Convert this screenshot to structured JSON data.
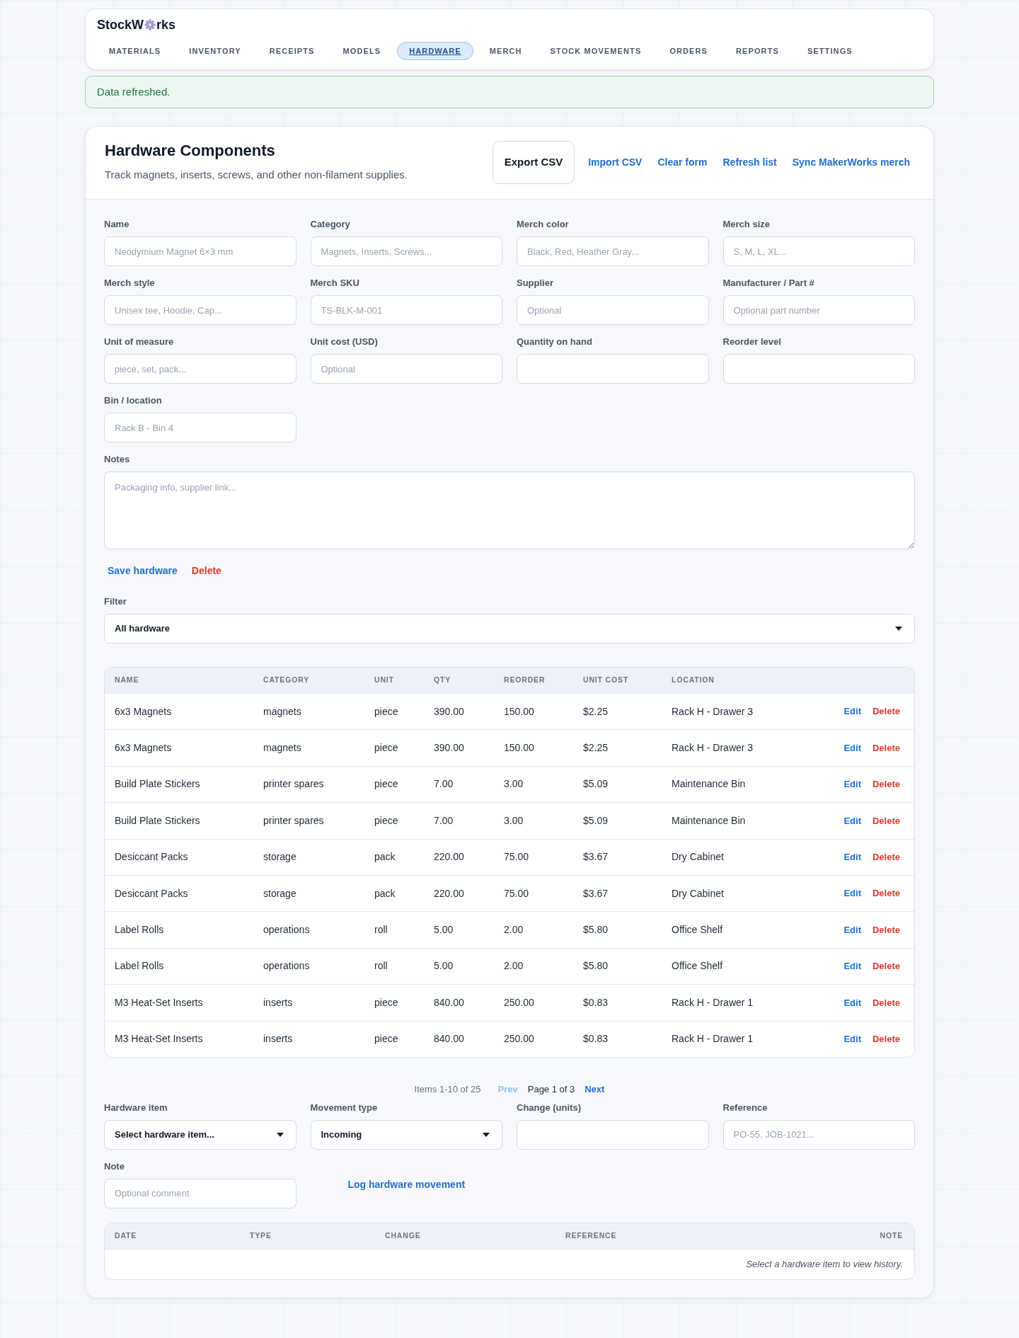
{
  "brand": {
    "text_start": "StockW",
    "text_end": "rks"
  },
  "nav": [
    {
      "label": "MATERIALS",
      "selected": false
    },
    {
      "label": "INVENTORY",
      "selected": false
    },
    {
      "label": "RECEIPTS",
      "selected": false
    },
    {
      "label": "MODELS",
      "selected": false
    },
    {
      "label": "HARDWARE",
      "selected": true
    },
    {
      "label": "MERCH",
      "selected": false
    },
    {
      "label": "STOCK MOVEMENTS",
      "selected": false
    },
    {
      "label": "ORDERS",
      "selected": false
    },
    {
      "label": "REPORTS",
      "selected": false
    },
    {
      "label": "SETTINGS",
      "selected": false
    }
  ],
  "alert": {
    "message": "Data refreshed."
  },
  "panel": {
    "title": "Hardware Components",
    "subtitle": "Track magnets, inserts, screws, and other non-filament supplies.",
    "actions": [
      {
        "label": "Export CSV",
        "kind": "outlined"
      },
      {
        "label": "Import CSV",
        "kind": "link"
      },
      {
        "label": "Clear form",
        "kind": "link"
      },
      {
        "label": "Refresh list",
        "kind": "link"
      },
      {
        "label": "Sync MakerWorks merch",
        "kind": "link"
      }
    ]
  },
  "form": {
    "fields": [
      {
        "label": "Name",
        "placeholder": "Neodymium Magnet 6×3 mm"
      },
      {
        "label": "Category",
        "placeholder": "Magnets, Inserts, Screws..."
      },
      {
        "label": "Merch color",
        "placeholder": "Black, Red, Heather Gray..."
      },
      {
        "label": "Merch size",
        "placeholder": "S, M, L, XL..."
      },
      {
        "label": "Merch style",
        "placeholder": "Unisex tee, Hoodie, Cap..."
      },
      {
        "label": "Merch SKU",
        "placeholder": "TS-BLK-M-001"
      },
      {
        "label": "Supplier",
        "placeholder": "Optional"
      },
      {
        "label": "Manufacturer / Part #",
        "placeholder": "Optional part number"
      },
      {
        "label": "Unit of measure",
        "placeholder": "piece, set, pack..."
      },
      {
        "label": "Unit cost (USD)",
        "placeholder": "Optional"
      },
      {
        "label": "Quantity on hand"
      },
      {
        "label": "Reorder level"
      },
      {
        "label": "Bin / location",
        "placeholder": "Rack B - Bin 4"
      }
    ],
    "notes": {
      "label": "Notes",
      "placeholder": "Packaging info, supplier link..."
    },
    "buttons": [
      {
        "label": "Save hardware",
        "kind": "primary"
      },
      {
        "label": "Delete",
        "kind": "danger"
      }
    ]
  },
  "filter": {
    "label": "Filter",
    "value": "All hardware"
  },
  "table": {
    "columns": [
      "NAME",
      "CATEGORY",
      "UNIT",
      "QTY",
      "REORDER",
      "UNIT COST",
      "LOCATION"
    ],
    "rows": [
      {
        "cells": [
          "6x3 Magnets",
          "magnets",
          "piece",
          "390.00",
          "150.00",
          "$2.25",
          "Rack H - Drawer 3"
        ],
        "actions": [
          {
            "label": "Edit",
            "kind": "primary"
          },
          {
            "label": "Delete",
            "kind": "danger"
          }
        ]
      },
      {
        "cells": [
          "6x3 Magnets",
          "magnets",
          "piece",
          "390.00",
          "150.00",
          "$2.25",
          "Rack H - Drawer 3"
        ],
        "actions": [
          {
            "label": "Edit",
            "kind": "primary"
          },
          {
            "label": "Delete",
            "kind": "danger"
          }
        ]
      },
      {
        "cells": [
          "Build Plate Stickers",
          "printer spares",
          "piece",
          "7.00",
          "3.00",
          "$5.09",
          "Maintenance Bin"
        ],
        "actions": [
          {
            "label": "Edit",
            "kind": "primary"
          },
          {
            "label": "Delete",
            "kind": "danger"
          }
        ]
      },
      {
        "cells": [
          "Build Plate Stickers",
          "printer spares",
          "piece",
          "7.00",
          "3.00",
          "$5.09",
          "Maintenance Bin"
        ],
        "actions": [
          {
            "label": "Edit",
            "kind": "primary"
          },
          {
            "label": "Delete",
            "kind": "danger"
          }
        ]
      },
      {
        "cells": [
          "Desiccant Packs",
          "storage",
          "pack",
          "220.00",
          "75.00",
          "$3.67",
          "Dry Cabinet"
        ],
        "actions": [
          {
            "label": "Edit",
            "kind": "primary"
          },
          {
            "label": "Delete",
            "kind": "danger"
          }
        ]
      },
      {
        "cells": [
          "Desiccant Packs",
          "storage",
          "pack",
          "220.00",
          "75.00",
          "$3.67",
          "Dry Cabinet"
        ],
        "actions": [
          {
            "label": "Edit",
            "kind": "primary"
          },
          {
            "label": "Delete",
            "kind": "danger"
          }
        ]
      },
      {
        "cells": [
          "Label Rolls",
          "operations",
          "roll",
          "5.00",
          "2.00",
          "$5.80",
          "Office Shelf"
        ],
        "actions": [
          {
            "label": "Edit",
            "kind": "primary"
          },
          {
            "label": "Delete",
            "kind": "danger"
          }
        ]
      },
      {
        "cells": [
          "Label Rolls",
          "operations",
          "roll",
          "5.00",
          "2.00",
          "$5.80",
          "Office Shelf"
        ],
        "actions": [
          {
            "label": "Edit",
            "kind": "primary"
          },
          {
            "label": "Delete",
            "kind": "danger"
          }
        ]
      },
      {
        "cells": [
          "M3 Heat-Set Inserts",
          "inserts",
          "piece",
          "840.00",
          "250.00",
          "$0.83",
          "Rack H - Drawer 1"
        ],
        "actions": [
          {
            "label": "Edit",
            "kind": "primary"
          },
          {
            "label": "Delete",
            "kind": "danger"
          }
        ]
      },
      {
        "cells": [
          "M3 Heat-Set Inserts",
          "inserts",
          "piece",
          "840.00",
          "250.00",
          "$0.83",
          "Rack H - Drawer 1"
        ],
        "actions": [
          {
            "label": "Edit",
            "kind": "primary"
          },
          {
            "label": "Delete",
            "kind": "danger"
          }
        ]
      }
    ]
  },
  "pagination": {
    "summary": "Items 1-10 of 25",
    "prev": {
      "label": "Prev",
      "disabled": true
    },
    "page": "Page 1 of 3",
    "next": {
      "label": "Next",
      "disabled": false
    }
  },
  "movement": {
    "fields": [
      {
        "kind": "select",
        "label": "Hardware item",
        "value": "Select hardware item..."
      },
      {
        "kind": "select",
        "label": "Movement type",
        "value": "Incoming"
      },
      {
        "kind": "input",
        "label": "Change (units)"
      },
      {
        "kind": "input",
        "label": "Reference",
        "placeholder": "PO-55, JOB-1021..."
      },
      {
        "kind": "input",
        "label": "Note",
        "placeholder": "Optional comment"
      }
    ],
    "submit": "Log hardware movement"
  },
  "history": {
    "columns": [
      "DATE",
      "TYPE",
      "CHANGE",
      "REFERENCE",
      "NOTE"
    ],
    "empty_message": "Select a hardware item to view history."
  }
}
